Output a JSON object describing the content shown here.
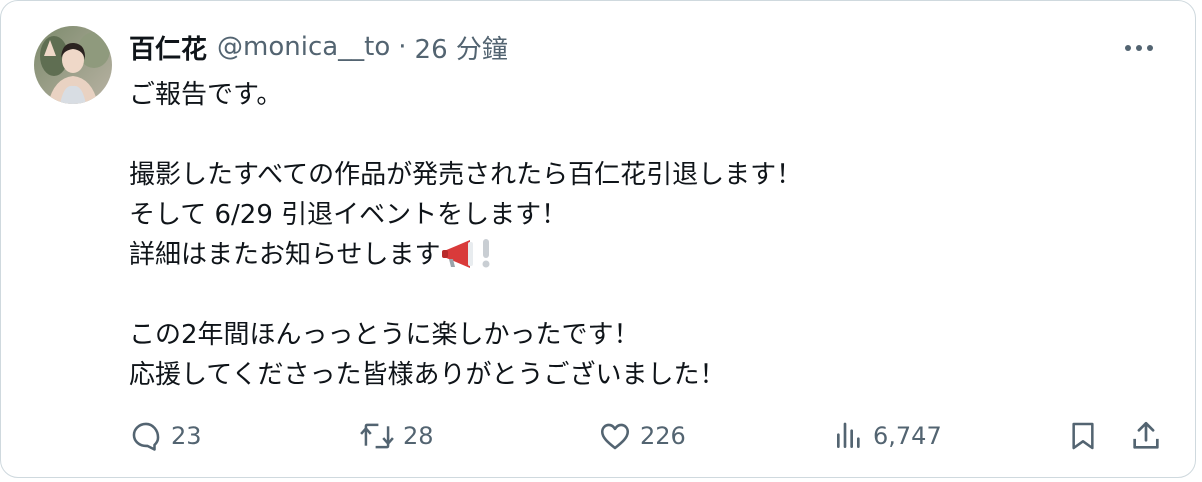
{
  "post": {
    "author": {
      "display_name": "百仁花",
      "handle": "@monica__to",
      "separator": "·",
      "time": "26 分鐘"
    },
    "body": {
      "line1": "ご報告です。",
      "line2": "撮影したすべての作品が発売されたら百仁花引退します！",
      "line3": "そして 6/29  引退イベントをします！",
      "line4": "詳細はまたお知らせします",
      "line5": "この2年間ほんっっとうに楽しかったです！",
      "line6": "応援してくださった皆様ありがとうございました！"
    },
    "emoji": [
      "megaphone-icon",
      "exclamation-icon"
    ],
    "stats": {
      "replies": "23",
      "reposts": "28",
      "likes": "226",
      "views": "6,747"
    }
  },
  "colors": {
    "text": "#0f1419",
    "secondary": "#536471",
    "border": "#cfd9de",
    "megaphone_red": "#d93a3a"
  },
  "icons": {
    "more": "more-icon",
    "reply": "reply-icon",
    "repost": "repost-icon",
    "like": "heart-icon",
    "views": "views-icon",
    "bookmark": "bookmark-icon",
    "share": "share-icon"
  }
}
